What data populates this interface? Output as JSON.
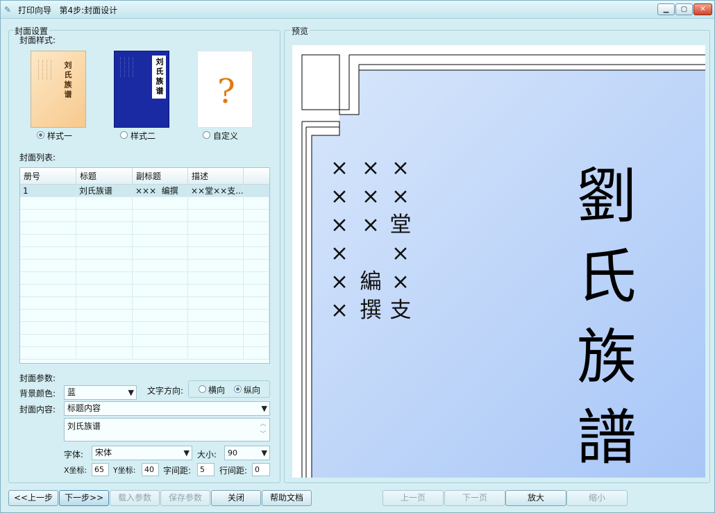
{
  "window": {
    "title": "打印向导   第4步:封面设计"
  },
  "cover_settings": {
    "group_title": "封面设置",
    "style_label": "封面样式:",
    "styles": [
      {
        "label": "样式一",
        "selected": true,
        "thumb_title": "刘氏族谱"
      },
      {
        "label": "样式二",
        "selected": false,
        "thumb_title": "刘氏族谱"
      },
      {
        "label": "自定义",
        "selected": false,
        "thumb_symbol": "?"
      }
    ],
    "list_label": "封面列表:",
    "table": {
      "columns": [
        "册号",
        "标题",
        "副标题",
        "描述"
      ],
      "rows": [
        [
          "1",
          "刘氏族谱",
          "×××  编撰",
          "××堂××支..."
        ]
      ]
    },
    "params_label": "封面参数:",
    "bg_color_label": "背景颜色:",
    "bg_color_value": "蓝",
    "text_dir_label": "文字方向:",
    "text_dir_horizontal": "横向",
    "text_dir_vertical": "纵向",
    "text_dir_selected": "vertical",
    "content_label": "封面内容:",
    "content_select": "标题内容",
    "content_text": "刘氏族谱",
    "font_label": "字体:",
    "font_value": "宋体",
    "size_label": "大小:",
    "size_value": "90",
    "x_label": "X坐标:",
    "x_value": "65",
    "y_label": "Y坐标:",
    "y_value": "40",
    "char_spacing_label": "字间距:",
    "char_spacing_value": "5",
    "line_spacing_label": "行间距:",
    "line_spacing_value": "0"
  },
  "preview": {
    "group_title": "预览",
    "title_chars": [
      "劉",
      "氏",
      "族",
      "譜"
    ],
    "subtitle_columns": [
      [
        "×",
        "×",
        "×",
        "×",
        "×",
        "×"
      ],
      [
        "×",
        "×",
        "×",
        "",
        "編",
        "撰"
      ],
      [
        "×",
        "×",
        "堂",
        "×",
        "×",
        "支"
      ]
    ],
    "bg_colors": [
      "#d7e6fb",
      "#a8c6f7"
    ]
  },
  "buttons": {
    "prev": "<<上一步",
    "next": "下一步>>",
    "load_params": "载入参数",
    "save_params": "保存参数",
    "close": "关闭",
    "help": "帮助文档",
    "prev_page": "上一页",
    "next_page": "下一页",
    "zoom_in": "放大",
    "zoom_out": "缩小"
  }
}
